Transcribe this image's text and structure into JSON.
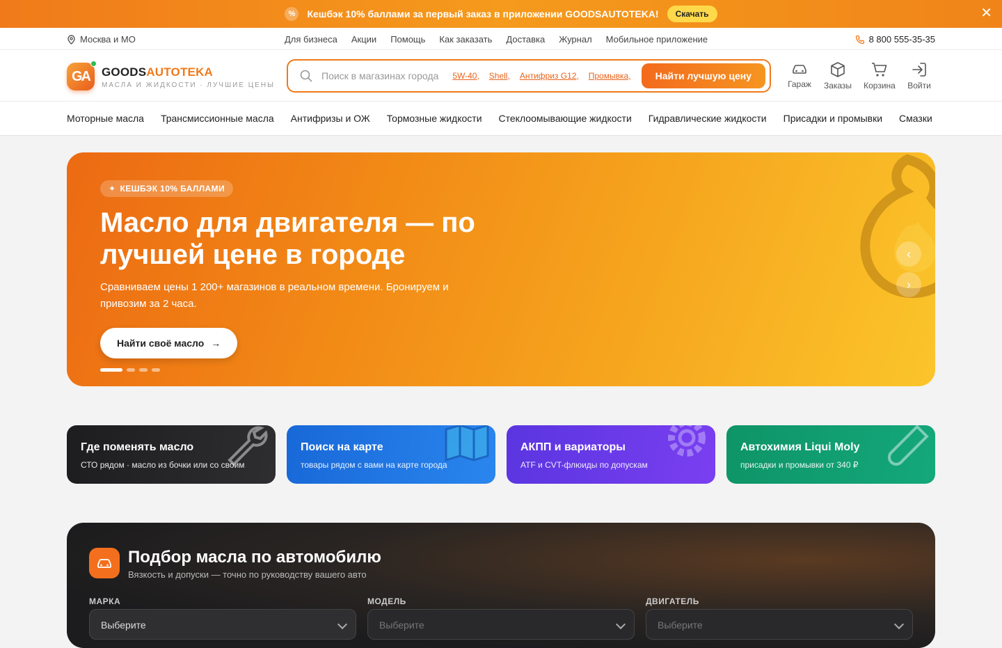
{
  "promo": {
    "text_pre": "Кешбэк ",
    "text_bold": "10% баллами",
    "text_post": " за первый заказ в приложении GOODSAUTOTEKA!",
    "download": "Скачать"
  },
  "topbar": {
    "city": "Москва и МО",
    "links": [
      "Для бизнеса",
      "Акции",
      "Помощь",
      "Как заказать",
      "Доставка",
      "Журнал",
      "Мобильное приложение"
    ],
    "phone": "8 800 555-35-35"
  },
  "logo": {
    "mark": "GA",
    "name_a": "GOODS",
    "name_b": "AUTOTEKA",
    "tagline": "МАСЛА И ЖИДКОСТИ · ЛУЧШИЕ ЦЕНЫ"
  },
  "search": {
    "placeholder": "Поиск в магазинах города",
    "tags": [
      "5W-40,",
      "Shell,",
      "Антифриз G12,",
      "Промывка,"
    ],
    "button": "Найти лучшую цену"
  },
  "header_icons": [
    {
      "label": "Гараж",
      "icon": "car-icon"
    },
    {
      "label": "Заказы",
      "icon": "box-icon"
    },
    {
      "label": "Корзина",
      "icon": "cart-icon"
    },
    {
      "label": "Войти",
      "icon": "login-icon"
    }
  ],
  "categories": [
    "Моторные масла",
    "Трансмиссионные масла",
    "Антифризы и ОЖ",
    "Тормозные жидкости",
    "Стеклоомывающие жидкости",
    "Гидравлические жидкости",
    "Присадки и промывки",
    "Смазки"
  ],
  "hero": {
    "badge": "КЕШБЭК 10% БАЛЛАМИ",
    "title": "Масло для двигателя — по лучшей цене в городе",
    "subtitle": "Сравниваем цены 1 200+ магазинов в реальном времени. Бронируем и привозим за 2 часа.",
    "cta": "Найти своё масло",
    "slides": 4,
    "active_slide": 1
  },
  "tiles": [
    {
      "title": "Где поменять масло",
      "desc": "СТО рядом · масло из бочки или со своим",
      "icon": "wrench-icon"
    },
    {
      "title": "Поиск на карте",
      "desc": "товары рядом с вами на карте города",
      "icon": "map-icon"
    },
    {
      "title": "АКПП и вариаторы",
      "desc": "ATF и CVT-флюиды по допускам",
      "icon": "gear-icon"
    },
    {
      "title": "Автохимия Liqui Moly",
      "desc": "присадки и промывки от 340 ₽",
      "icon": "test-tube-icon"
    }
  ],
  "picker": {
    "title": "Подбор масла по автомобилю",
    "subtitle": "Вязкость и допуски — точно по руководству вашего авто",
    "fields": [
      {
        "label": "МАРКА",
        "value": "Выберите"
      },
      {
        "label": "МОДЕЛЬ",
        "value": "Выберите"
      },
      {
        "label": "ДВИГАТЕЛЬ",
        "value": "Выберите"
      }
    ]
  },
  "colors": {
    "accent": "#f07a1a",
    "link": "#e8631a",
    "promo_button": "#ffd94a"
  }
}
